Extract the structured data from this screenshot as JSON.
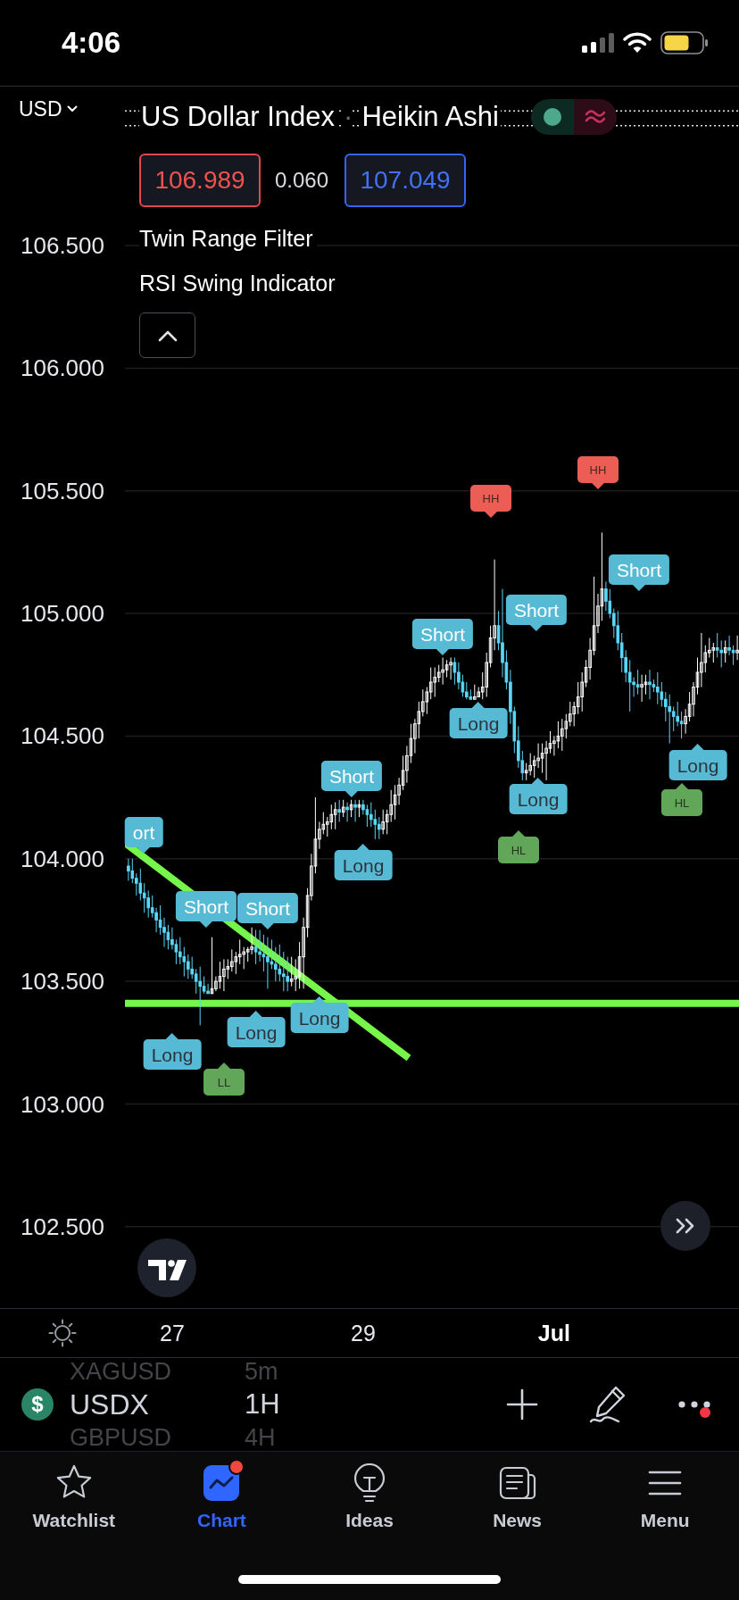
{
  "status_bar": {
    "time": "4:06"
  },
  "header": {
    "currency": "USD",
    "symbol_name": "US Dollar Index",
    "separator": "·",
    "chart_style": "Heikin Ashi"
  },
  "quote": {
    "sell": "106.989",
    "spread": "0.060",
    "buy": "107.049"
  },
  "legend": {
    "expanded": true,
    "indicators": [
      {
        "name": "Twin Range Filter"
      },
      {
        "name": "RSI Swing Indicator"
      }
    ]
  },
  "chart": {
    "chart_data": {
      "type": "candlestick",
      "x": [
        26.542,
        26.583,
        26.625,
        26.667,
        26.708,
        26.75,
        26.792,
        26.833,
        26.875,
        26.917,
        26.958,
        27,
        27.042,
        27.083,
        27.125,
        27.167,
        27.208,
        27.25,
        27.292,
        27.333,
        27.375,
        27.417,
        27.458,
        27.5,
        27.542,
        27.583,
        27.625,
        27.667,
        27.708,
        27.75,
        27.792,
        27.833,
        27.875,
        27.917,
        27.958,
        28,
        28.042,
        28.083,
        28.125,
        28.167,
        28.208,
        28.25,
        28.292,
        28.333,
        28.375,
        28.417,
        28.458,
        28.5,
        28.542,
        28.583,
        28.625,
        28.667,
        28.708,
        28.75,
        28.792,
        28.833,
        28.875,
        28.917,
        28.958,
        29,
        29.042,
        29.083,
        29.125,
        29.167,
        29.208,
        29.25,
        29.292,
        29.333,
        29.375,
        29.417,
        29.458,
        29.5,
        29.542,
        29.583,
        29.625,
        29.667,
        29.708,
        29.75,
        29.792,
        29.833,
        29.875,
        29.917,
        29.958,
        30,
        30.042,
        30.083,
        30.125,
        30.167,
        30.208,
        30.25,
        30.292,
        30.333,
        30.375,
        30.417,
        30.458,
        30.5,
        30.542,
        30.583,
        30.625,
        30.667,
        30.708,
        30.75,
        30.792,
        30.833,
        30.875,
        30.917,
        30.958,
        31,
        31.042,
        31.083,
        31.125,
        31.167,
        31.208,
        31.25,
        31.292,
        31.333,
        31.375,
        31.417,
        31.458,
        31.5,
        31.542,
        31.583,
        31.625,
        31.667,
        31.708,
        31.75,
        31.792,
        31.833,
        31.875,
        31.917,
        31.958,
        32,
        32.042,
        32.083,
        32.125,
        32.167,
        32.208,
        32.25,
        32.292,
        32.333,
        32.375,
        32.417,
        32.458,
        32.5,
        32.542,
        32.583,
        32.625,
        32.667,
        32.708,
        32.75,
        32.792,
        32.833,
        32.875,
        32.917
      ],
      "ohlc": [
        [
          103.97,
          104.0,
          103.91,
          103.95
        ],
        [
          103.95,
          104.0,
          103.9,
          103.92
        ],
        [
          103.92,
          103.94,
          103.85,
          103.9
        ],
        [
          103.9,
          103.96,
          103.83,
          103.86
        ],
        [
          103.86,
          103.9,
          103.78,
          103.84
        ],
        [
          103.84,
          103.87,
          103.76,
          103.8
        ],
        [
          103.8,
          103.85,
          103.76,
          103.78
        ],
        [
          103.78,
          103.8,
          103.7,
          103.75
        ],
        [
          103.75,
          103.81,
          103.69,
          103.72
        ],
        [
          103.72,
          103.76,
          103.64,
          103.7
        ],
        [
          103.7,
          103.73,
          103.63,
          103.67
        ],
        [
          103.67,
          103.72,
          103.63,
          103.65
        ],
        [
          103.65,
          103.67,
          103.57,
          103.62
        ],
        [
          103.62,
          103.68,
          103.57,
          103.6
        ],
        [
          103.6,
          103.64,
          103.52,
          103.58
        ],
        [
          103.58,
          103.61,
          103.51,
          103.55
        ],
        [
          103.55,
          103.6,
          103.51,
          103.53
        ],
        [
          103.53,
          103.55,
          103.45,
          103.5
        ],
        [
          103.5,
          103.56,
          103.32,
          103.48
        ],
        [
          103.48,
          103.52,
          103.45,
          103.46
        ],
        [
          103.46,
          103.49,
          103.45,
          103.45
        ],
        [
          103.45,
          103.68,
          103.45,
          103.47
        ],
        [
          103.47,
          103.52,
          103.46,
          103.5
        ],
        [
          103.5,
          103.58,
          103.47,
          103.52
        ],
        [
          103.52,
          103.59,
          103.46,
          103.55
        ],
        [
          103.55,
          103.59,
          103.51,
          103.56
        ],
        [
          103.56,
          103.63,
          103.54,
          103.58
        ],
        [
          103.58,
          103.62,
          103.53,
          103.6
        ],
        [
          103.6,
          103.67,
          103.57,
          103.61
        ],
        [
          103.61,
          103.64,
          103.55,
          103.62
        ],
        [
          103.62,
          103.64,
          103.58,
          103.63
        ],
        [
          103.63,
          103.72,
          103.61,
          103.64
        ],
        [
          103.64,
          103.71,
          103.57,
          103.62
        ],
        [
          103.62,
          103.71,
          103.58,
          103.61
        ],
        [
          103.61,
          103.69,
          103.54,
          103.6
        ],
        [
          103.6,
          103.68,
          103.47,
          103.58
        ],
        [
          103.58,
          103.67,
          103.55,
          103.57
        ],
        [
          103.57,
          103.64,
          103.5,
          103.55
        ],
        [
          103.55,
          103.65,
          103.5,
          103.53
        ],
        [
          103.53,
          103.62,
          103.46,
          103.52
        ],
        [
          103.52,
          103.6,
          103.46,
          103.5
        ],
        [
          103.5,
          103.6,
          103.48,
          103.51
        ],
        [
          103.51,
          103.59,
          103.46,
          103.52
        ],
        [
          103.52,
          103.66,
          103.47,
          103.6
        ],
        [
          103.6,
          103.76,
          103.47,
          103.72
        ],
        [
          103.72,
          103.88,
          103.68,
          103.85
        ],
        [
          103.85,
          104.02,
          103.83,
          103.97
        ],
        [
          103.97,
          104.25,
          103.94,
          104.08
        ],
        [
          104.08,
          104.15,
          104.04,
          104.12
        ],
        [
          104.12,
          104.19,
          104.1,
          104.14
        ],
        [
          104.14,
          104.17,
          104.09,
          104.15
        ],
        [
          104.15,
          104.22,
          104.12,
          104.18
        ],
        [
          104.18,
          104.23,
          104.12,
          104.2
        ],
        [
          104.2,
          104.24,
          104.15,
          104.19
        ],
        [
          104.19,
          104.24,
          104.17,
          104.21
        ],
        [
          104.21,
          104.23,
          104.15,
          104.2
        ],
        [
          104.2,
          104.24,
          104.17,
          104.22
        ],
        [
          104.22,
          104.24,
          104.15,
          104.21
        ],
        [
          104.21,
          104.24,
          104.17,
          104.22
        ],
        [
          104.22,
          104.24,
          104.18,
          104.2
        ],
        [
          104.2,
          104.22,
          104.13,
          104.18
        ],
        [
          104.18,
          104.23,
          104.13,
          104.16
        ],
        [
          104.16,
          104.2,
          104.08,
          104.14
        ],
        [
          104.14,
          104.17,
          104.08,
          104.12
        ],
        [
          104.12,
          104.2,
          104.1,
          104.15
        ],
        [
          104.15,
          104.2,
          104.1,
          104.18
        ],
        [
          104.18,
          104.28,
          104.15,
          104.22
        ],
        [
          104.22,
          104.3,
          104.16,
          104.26
        ],
        [
          104.26,
          104.33,
          104.22,
          104.3
        ],
        [
          104.3,
          104.42,
          104.28,
          104.36
        ],
        [
          104.36,
          104.46,
          104.31,
          104.42
        ],
        [
          104.42,
          104.55,
          104.39,
          104.49
        ],
        [
          104.49,
          104.57,
          104.43,
          104.55
        ],
        [
          104.55,
          104.64,
          104.49,
          104.6
        ],
        [
          104.6,
          104.69,
          104.58,
          104.64
        ],
        [
          104.64,
          104.7,
          104.59,
          104.68
        ],
        [
          104.68,
          104.78,
          104.65,
          104.72
        ],
        [
          104.72,
          104.78,
          104.66,
          104.74
        ],
        [
          104.74,
          104.79,
          104.72,
          104.76
        ],
        [
          104.76,
          104.82,
          104.71,
          104.77
        ],
        [
          104.77,
          104.81,
          104.74,
          104.79
        ],
        [
          104.79,
          104.82,
          104.73,
          104.8
        ],
        [
          104.8,
          104.82,
          104.71,
          104.76
        ],
        [
          104.76,
          104.8,
          104.69,
          104.72
        ],
        [
          104.72,
          104.75,
          104.66,
          104.68
        ],
        [
          104.68,
          104.72,
          104.65,
          104.66
        ],
        [
          104.66,
          104.69,
          104.65,
          104.65
        ],
        [
          104.65,
          104.71,
          104.65,
          104.66
        ],
        [
          104.66,
          104.7,
          104.66,
          104.68
        ],
        [
          104.68,
          104.76,
          104.65,
          104.7
        ],
        [
          104.7,
          104.84,
          104.66,
          104.8
        ],
        [
          104.8,
          104.95,
          104.78,
          104.9
        ],
        [
          104.9,
          105.22,
          104.85,
          104.95
        ],
        [
          104.95,
          105.01,
          104.85,
          104.88
        ],
        [
          104.88,
          105.1,
          104.74,
          104.8
        ],
        [
          104.8,
          104.85,
          104.69,
          104.72
        ],
        [
          104.72,
          104.77,
          104.55,
          104.6
        ],
        [
          104.6,
          104.62,
          104.43,
          104.48
        ],
        [
          104.48,
          104.54,
          104.37,
          104.4
        ],
        [
          104.4,
          104.44,
          104.32,
          104.35
        ],
        [
          104.35,
          104.39,
          104.32,
          104.36
        ],
        [
          104.36,
          104.43,
          104.34,
          104.38
        ],
        [
          104.38,
          104.42,
          104.33,
          104.4
        ],
        [
          104.4,
          104.47,
          104.37,
          104.41
        ],
        [
          104.41,
          104.47,
          104.35,
          104.43
        ],
        [
          104.43,
          104.48,
          104.32,
          104.45
        ],
        [
          104.45,
          104.52,
          104.43,
          104.47
        ],
        [
          104.47,
          104.5,
          104.42,
          104.48
        ],
        [
          104.48,
          104.56,
          104.45,
          104.5
        ],
        [
          104.5,
          104.57,
          104.44,
          104.53
        ],
        [
          104.53,
          104.59,
          104.49,
          104.56
        ],
        [
          104.56,
          104.64,
          104.54,
          104.59
        ],
        [
          104.59,
          104.64,
          104.54,
          104.62
        ],
        [
          104.62,
          104.72,
          104.59,
          104.66
        ],
        [
          104.66,
          104.76,
          104.6,
          104.72
        ],
        [
          104.72,
          104.81,
          104.7,
          104.78
        ],
        [
          104.78,
          104.9,
          104.73,
          104.85
        ],
        [
          104.85,
          105.15,
          104.83,
          104.95
        ],
        [
          104.95,
          105.08,
          104.92,
          105.03
        ],
        [
          105.03,
          105.33,
          104.97,
          105.1
        ],
        [
          105.1,
          105.13,
          105.01,
          105.05
        ],
        [
          105.05,
          105.1,
          104.98,
          105.0
        ],
        [
          105.0,
          105.02,
          104.9,
          104.95
        ],
        [
          104.95,
          105.01,
          104.85,
          104.88
        ],
        [
          104.88,
          104.92,
          104.76,
          104.82
        ],
        [
          104.82,
          104.85,
          104.72,
          104.76
        ],
        [
          104.76,
          104.81,
          104.6,
          104.72
        ],
        [
          104.72,
          104.74,
          104.66,
          104.71
        ],
        [
          104.71,
          104.77,
          104.67,
          104.7
        ],
        [
          104.7,
          104.75,
          104.64,
          104.71
        ],
        [
          104.71,
          104.75,
          104.67,
          104.72
        ],
        [
          104.72,
          104.77,
          104.65,
          104.71
        ],
        [
          104.71,
          104.73,
          104.68,
          104.7
        ],
        [
          104.7,
          104.76,
          104.63,
          104.68
        ],
        [
          104.68,
          104.72,
          104.62,
          104.65
        ],
        [
          104.65,
          104.68,
          104.56,
          104.62
        ],
        [
          104.62,
          104.67,
          104.47,
          104.6
        ],
        [
          104.6,
          104.62,
          104.52,
          104.58
        ],
        [
          104.58,
          104.64,
          104.54,
          104.56
        ],
        [
          104.56,
          104.6,
          104.49,
          104.55
        ],
        [
          104.55,
          104.61,
          104.51,
          104.58
        ],
        [
          104.58,
          104.68,
          104.56,
          104.63
        ],
        [
          104.63,
          104.72,
          104.58,
          104.7
        ],
        [
          104.7,
          104.82,
          104.67,
          104.76
        ],
        [
          104.76,
          104.92,
          104.7,
          104.8
        ],
        [
          104.8,
          104.87,
          104.76,
          104.84
        ],
        [
          104.84,
          104.9,
          104.82,
          104.85
        ],
        [
          104.85,
          104.88,
          104.8,
          104.86
        ],
        [
          104.86,
          104.92,
          104.82,
          104.85
        ],
        [
          104.85,
          104.89,
          104.78,
          104.84
        ],
        [
          104.84,
          104.89,
          104.8,
          104.86
        ],
        [
          104.86,
          104.91,
          104.83,
          104.85
        ],
        [
          104.85,
          104.87,
          104.79,
          104.84
        ],
        [
          104.84,
          104.91,
          104.81,
          104.85
        ]
      ],
      "xlim": [
        25.197,
        32.935
      ],
      "ylim": [
        102.168,
        107.148
      ],
      "xticks": [
        27,
        29,
        {
          "value": 31,
          "label": "Jul"
        }
      ],
      "yticks": [
        {
          "value": 106.5,
          "label": "106.500"
        },
        {
          "value": 106.0,
          "label": "106.000"
        },
        {
          "value": 105.5,
          "label": "105.500"
        },
        {
          "value": 105.0,
          "label": "105.000"
        },
        {
          "value": 104.5,
          "label": "104.500"
        },
        {
          "value": 104.0,
          "label": "104.000"
        },
        {
          "value": 103.5,
          "label": "103.500"
        },
        {
          "value": 103.0,
          "label": "103.000"
        },
        {
          "value": 102.5,
          "label": "102.500"
        }
      ],
      "grid": true,
      "ref_lines": [
        {
          "axis": "y",
          "value": 107.049,
          "color": "#e6e6e6"
        },
        {
          "axis": "y",
          "value": 106.989,
          "color": "#e6e6e6"
        },
        {
          "axis": "y",
          "value": 103.41,
          "color": "#76f54a"
        }
      ]
    },
    "markers": [
      {
        "text": "HH",
        "kind": "swing_high"
      },
      {
        "text": "HH",
        "kind": "swing_high"
      },
      {
        "text": "Short",
        "kind": "short"
      },
      {
        "text": "Short",
        "kind": "short"
      },
      {
        "text": "Short",
        "kind": "short"
      },
      {
        "text": "Long",
        "kind": "long"
      },
      {
        "text": "Long",
        "kind": "long"
      },
      {
        "text": "Short",
        "kind": "short"
      },
      {
        "text": "Long",
        "kind": "long"
      },
      {
        "text": "HL",
        "kind": "swing_low"
      },
      {
        "text": "ort",
        "kind": "short"
      },
      {
        "text": "HL",
        "kind": "swing_low"
      },
      {
        "text": "Long",
        "kind": "long"
      },
      {
        "text": "Short",
        "kind": "short"
      },
      {
        "text": "Short",
        "kind": "short"
      },
      {
        "text": "Long",
        "kind": "long"
      },
      {
        "text": "Long",
        "kind": "long"
      },
      {
        "text": "Long",
        "kind": "long"
      },
      {
        "text": "LL",
        "kind": "swing_low"
      }
    ]
  },
  "symbol_bar": {
    "option_above": {
      "symbol": "XAGUSD",
      "interval": "5m"
    },
    "current": {
      "icon": "$",
      "symbol": "USDX",
      "interval": "1H"
    },
    "option_below": {
      "symbol": "GBPUSD",
      "interval": "4H"
    },
    "menu_badge": true
  },
  "tab_bar": [
    {
      "label": "Watchlist",
      "selected": false,
      "badge": false
    },
    {
      "label": "Chart",
      "selected": true,
      "badge": true
    },
    {
      "label": "Ideas",
      "selected": false,
      "badge": false
    },
    {
      "label": "News",
      "selected": false,
      "badge": false
    },
    {
      "label": "Menu",
      "selected": false,
      "badge": false
    }
  ]
}
